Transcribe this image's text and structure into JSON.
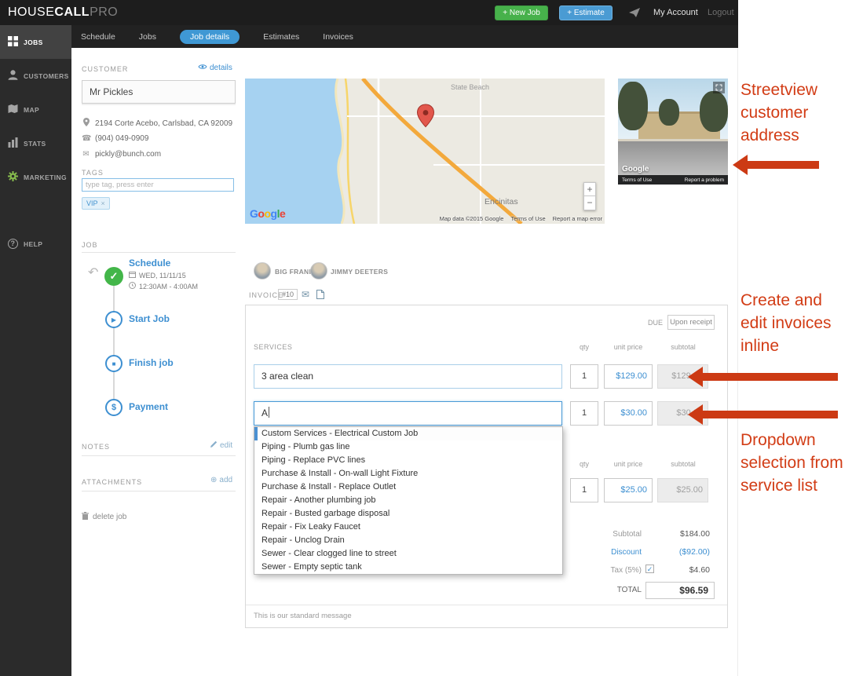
{
  "icons": {
    "help": "?",
    "check": "✓",
    "play": "▶",
    "stop": "■",
    "dollar": "$",
    "undo": "↶",
    "phone": "☎",
    "mail": "✉",
    "plus_circle": "⊕",
    "tax_check": "✓",
    "close": "×"
  },
  "topbar": {
    "logo_house": "HOUSE",
    "logo_call": "CALL",
    "logo_pro": "PRO",
    "new_job_label": "+ New Job",
    "estimate_label": "+ Estimate",
    "my_account_label": "My Account",
    "logout_label": "Logout"
  },
  "sidebar": {
    "items": [
      {
        "label": "JOBS"
      },
      {
        "label": "CUSTOMERS"
      },
      {
        "label": "MAP"
      },
      {
        "label": "STATS"
      },
      {
        "label": "MARKETING"
      },
      {
        "label": "HELP"
      }
    ]
  },
  "nav": {
    "tabs": [
      "Schedule",
      "Jobs",
      "Job details",
      "Estimates",
      "Invoices"
    ]
  },
  "customer": {
    "section_label": "CUSTOMER",
    "details_link": "details",
    "name": "Mr Pickles",
    "address": "2194 Corte Acebo, Carlsbad, CA 92009",
    "phone": "(904) 049-0909",
    "email": "pickly@bunch.com",
    "tags_label": "TAGS",
    "tag_placeholder": "type tag, press enter",
    "tag": "VIP"
  },
  "job": {
    "section_label": "JOB",
    "schedule_label": "Schedule",
    "schedule_date": "WED, 11/11/15",
    "schedule_time": "12:30AM - 4:00AM",
    "start_label": "Start Job",
    "finish_label": "Finish job",
    "payment_label": "Payment",
    "notes_label": "NOTES",
    "edit_link": "edit",
    "attachments_label": "ATTACHMENTS",
    "add_link": "add",
    "delete_link": "delete job"
  },
  "team": {
    "member1": "BIG FRANK",
    "member2": "JIMMY DEETERS"
  },
  "map": {
    "label_state_beach": "State Beach",
    "label_encinitas": "Encinitas",
    "zoom_in": "+",
    "zoom_out": "−",
    "logo_letters": [
      "G",
      "o",
      "o",
      "g",
      "l",
      "e"
    ],
    "attribution": "Map data ©2015 Google",
    "terms": "Terms of Use",
    "report": "Report a map error"
  },
  "streetview": {
    "logo": "Google",
    "terms": "Terms of Use",
    "report": "Report a problem"
  },
  "invoice": {
    "section_label": "INVOICE",
    "number": "#10",
    "due_label": "DUE",
    "due_value": "Upon receipt",
    "services_label": "SERVICES",
    "col_qty": "qty",
    "col_unit_price": "unit price",
    "col_subtotal": "subtotal",
    "rows": [
      {
        "name": "3 area clean",
        "qty": "1",
        "unit_price": "$129.00",
        "subtotal": "$129.00"
      },
      {
        "name": "A",
        "qty": "1",
        "unit_price": "$30.00",
        "subtotal": "$30.00"
      }
    ],
    "materials_row": {
      "qty": "1",
      "unit_price": "$25.00",
      "subtotal": "$25.00"
    },
    "totals": {
      "subtotal_label": "Subtotal",
      "subtotal_value": "$184.00",
      "discount_label": "Discount",
      "discount_value": "($92.00)",
      "tax_label": "Tax (5%)",
      "tax_value": "$4.60",
      "total_label": "TOTAL",
      "total_value": "$96.59"
    },
    "message": "This is our standard message"
  },
  "dropdown": {
    "items": [
      "Custom Services - Electrical Custom Job",
      "Piping - Plumb gas line",
      "Piping - Replace PVC lines",
      "Purchase & Install - On-wall Light Fixture",
      "Purchase & Install - Replace Outlet",
      "Repair - Another plumbing job",
      "Repair - Busted garbage disposal",
      "Repair - Fix Leaky Faucet",
      "Repair - Unclog Drain",
      "Sewer - Clear clogged line to street",
      "Sewer - Empty septic tank"
    ]
  },
  "annotations": {
    "streetview": "Streetview\ncustomer\naddress",
    "invoices": "Create and\nedit invoices\ninline",
    "dropdown": "Dropdown\nselection from\nservice list"
  }
}
